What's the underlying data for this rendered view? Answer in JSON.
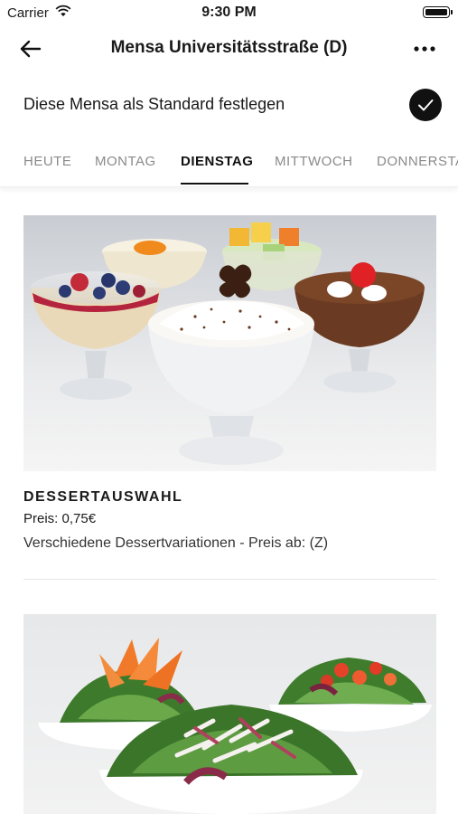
{
  "status_bar": {
    "carrier": "Carrier",
    "time": "9:30 PM"
  },
  "header": {
    "title": "Mensa Universitätsstraße (D)",
    "back_icon": "arrow-left-icon",
    "more_icon": "more-horizontal-icon"
  },
  "default_setting": {
    "label": "Diese Mensa als Standard festlegen",
    "icon": "checkmark-icon",
    "checked": true
  },
  "tabs": [
    {
      "label": "HEUTE"
    },
    {
      "label": "MONTAG"
    },
    {
      "label": "DIENSTAG"
    },
    {
      "label": "MITTWOCH"
    },
    {
      "label": "DONNERSTAG"
    }
  ],
  "active_tab": "DIENSTAG",
  "menu_items": [
    {
      "name": "DESSERTAUSWAHL",
      "price": "Preis: 0,75€",
      "description": "Verschiedene Dessertvariationen - Preis ab: (Z)",
      "image": "dessert-photo"
    },
    {
      "image": "salad-photo"
    }
  ],
  "colors": {
    "text": "#1a1a1a",
    "muted": "#8a8a8a",
    "accent": "#111111",
    "divider": "#e6e6e6"
  }
}
